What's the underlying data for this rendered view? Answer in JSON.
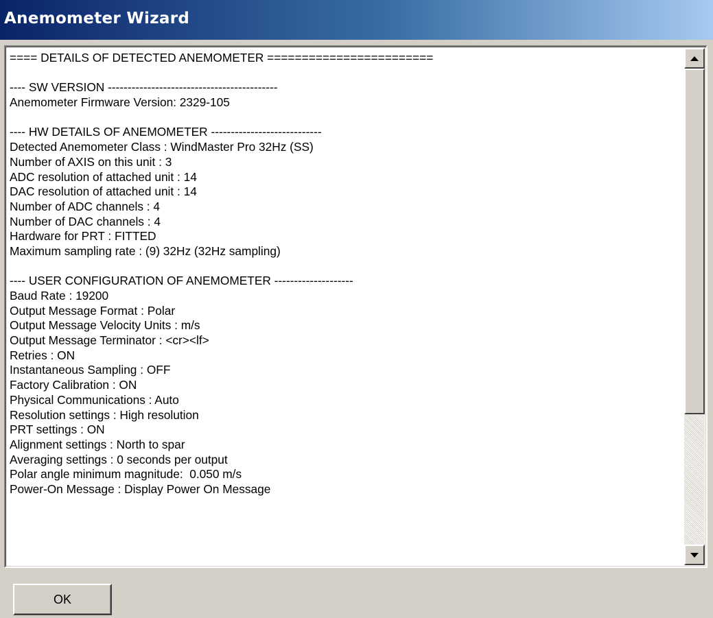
{
  "window": {
    "title": "Anemometer Wizard"
  },
  "details": {
    "lines": [
      "==== DETAILS OF DETECTED ANEMOMETER ========================",
      "",
      "---- SW VERSION -------------------------------------------",
      "Anemometer Firmware Version: 2329-105",
      "",
      "---- HW DETAILS OF ANEMOMETER ----------------------------",
      "Detected Anemometer Class : WindMaster Pro 32Hz (SS)",
      "Number of AXIS on this unit : 3",
      "ADC resolution of attached unit : 14",
      "DAC resolution of attached unit : 14",
      "Number of ADC channels : 4",
      "Number of DAC channels : 4",
      "Hardware for PRT : FITTED",
      "Maximum sampling rate : (9) 32Hz (32Hz sampling)",
      "",
      "---- USER CONFIGURATION OF ANEMOMETER --------------------",
      "Baud Rate : 19200",
      "Output Message Format : Polar",
      "Output Message Velocity Units : m/s",
      "Output Message Terminator : <cr><lf>",
      "Retries : ON",
      "Instantaneous Sampling : OFF",
      "Factory Calibration : ON",
      "Physical Communications : Auto",
      "Resolution settings : High resolution",
      "PRT settings : ON",
      "Alignment settings : North to spar",
      "Averaging settings : 0 seconds per output",
      "Polar angle minimum magnitude:  0.050 m/s",
      "Power-On Message : Display Power On Message"
    ]
  },
  "scrollbar": {
    "up_icon": "arrow-up-icon",
    "down_icon": "arrow-down-icon",
    "position": 0
  },
  "buttons": {
    "ok_label": "OK"
  },
  "colors": {
    "titlebar_start": "#0a246a",
    "titlebar_end": "#a6caf0",
    "face": "#d4d0c8"
  }
}
